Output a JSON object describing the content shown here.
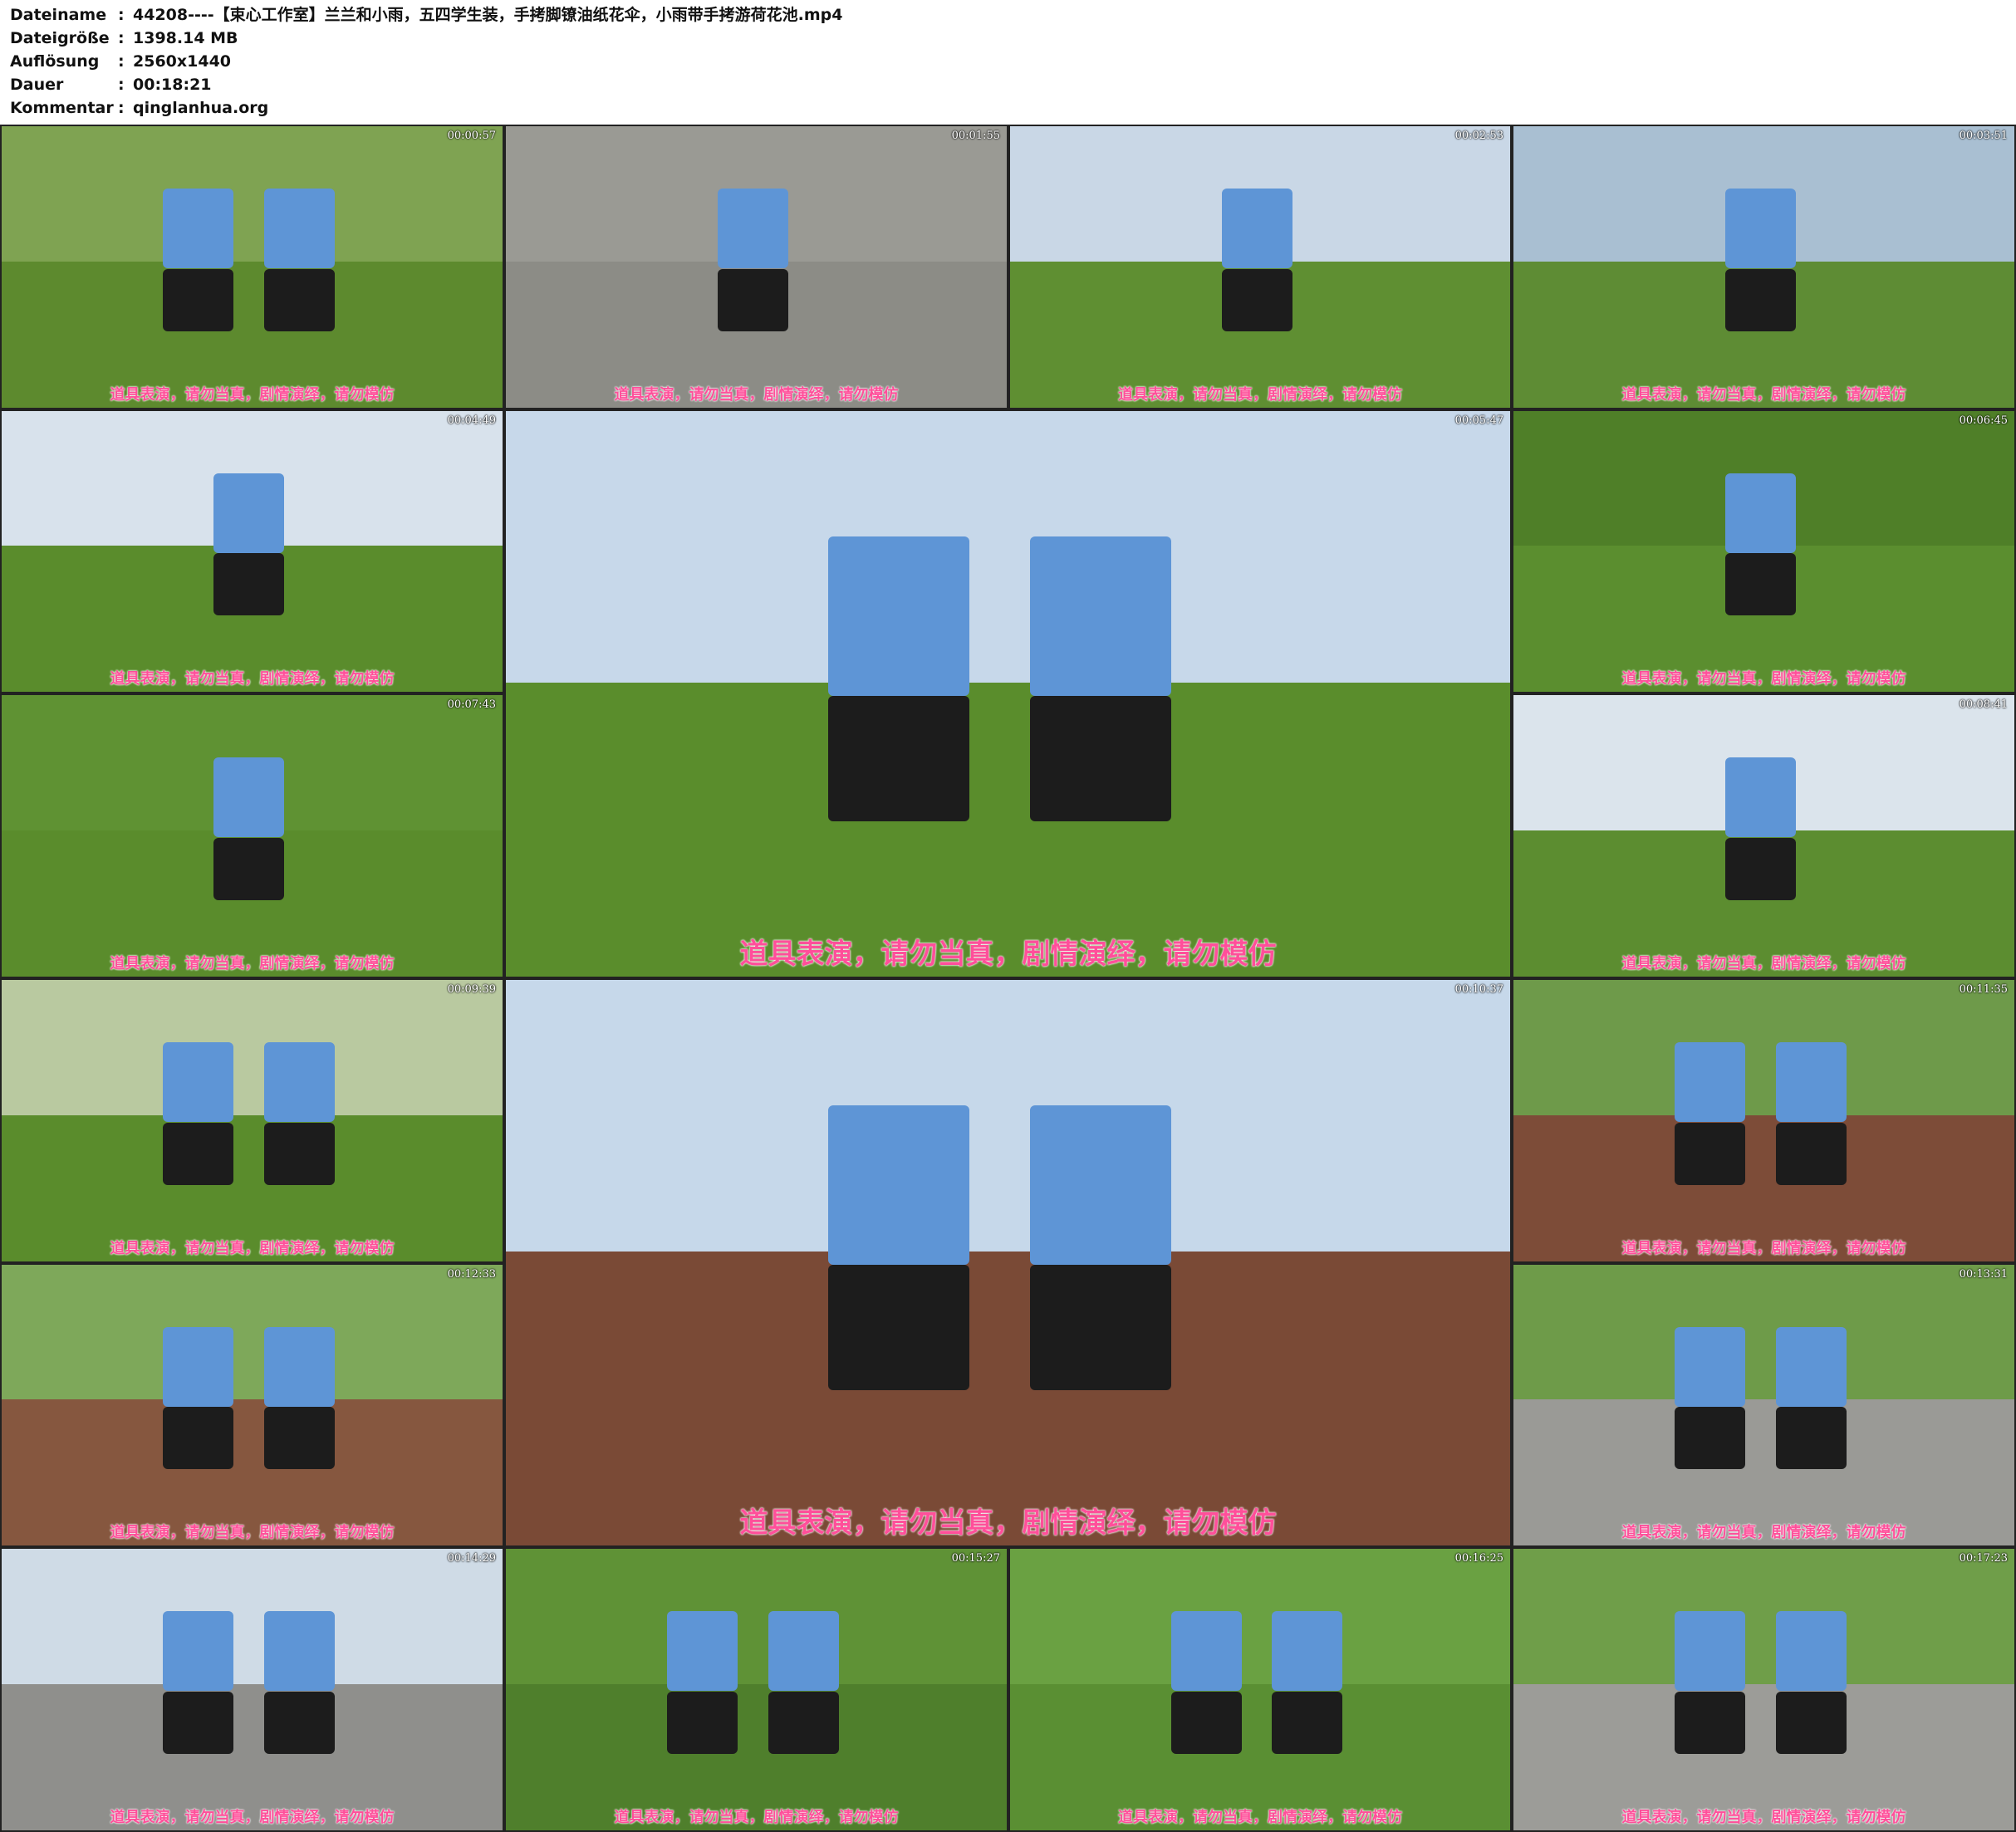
{
  "meta": [
    {
      "key": "Dateiname",
      "value": "44208----【束心工作室】兰兰和小雨，五四学生装，手拷脚镣油纸花伞，小雨带手拷游荷花池.mp4"
    },
    {
      "key": "Dateigröße",
      "value": "1398.14 MB"
    },
    {
      "key": "Auflösung",
      "value": "2560x1440"
    },
    {
      "key": "Dauer",
      "value": "00:18:21"
    },
    {
      "key": "Kommentar",
      "value": "qinglanhua.org"
    }
  ],
  "colon": ":",
  "caption": "道具表演，请勿当真，剧情演绎，请勿模仿",
  "thumbnails": [
    {
      "timestamp": "00:00:57",
      "scene": "grass-path",
      "sky": "#7fa352",
      "ground": "#5d8a2e"
    },
    {
      "timestamp": "00:01:55",
      "scene": "pavement",
      "sky": "#9a9a94",
      "ground": "#8c8c86"
    },
    {
      "timestamp": "00:02:53",
      "scene": "statue-field",
      "sky": "#c9d7e6",
      "ground": "#5f8f32"
    },
    {
      "timestamp": "00:03:51",
      "scene": "statue-field",
      "sky": "#a9bfd2",
      "ground": "#5e8c34"
    },
    {
      "timestamp": "00:04:49",
      "scene": "grass-slope",
      "sky": "#d8e2ec",
      "ground": "#5a8c2c"
    },
    {
      "timestamp": "00:05:47",
      "scene": "willow-umbrella",
      "sky": "#c7d8ea",
      "ground": "#5a8d2c"
    },
    {
      "timestamp": "00:06:45",
      "scene": "feet-grass",
      "sky": "#4f7f28",
      "ground": "#5b8e2f"
    },
    {
      "timestamp": "00:07:43",
      "scene": "grass-slope",
      "sky": "#5f9233",
      "ground": "#5a8c2c"
    },
    {
      "timestamp": "00:08:41",
      "scene": "willow-field",
      "sky": "#dbe4ec",
      "ground": "#5c8d30"
    },
    {
      "timestamp": "00:09:39",
      "scene": "willow-umbrella",
      "sky": "#b9c9a0",
      "ground": "#5a8c2c"
    },
    {
      "timestamp": "00:10:37",
      "scene": "boardwalk-lotus",
      "sky": "#c6d8ea",
      "ground": "#7a4a36"
    },
    {
      "timestamp": "00:11:35",
      "scene": "boardwalk",
      "sky": "#6e9a4a",
      "ground": "#7d4c38"
    },
    {
      "timestamp": "00:12:33",
      "scene": "boardwalk-lotus",
      "sky": "#7ea85a",
      "ground": "#86573f"
    },
    {
      "timestamp": "00:13:31",
      "scene": "stone-path",
      "sky": "#6e9b49",
      "ground": "#9a9a96"
    },
    {
      "timestamp": "00:14:29",
      "scene": "stone-path",
      "sky": "#cfdbe6",
      "ground": "#8f8f8c"
    },
    {
      "timestamp": "00:15:27",
      "scene": "lotus-close",
      "sky": "#5f9236",
      "ground": "#4f7f2c"
    },
    {
      "timestamp": "00:16:25",
      "scene": "lotus-close",
      "sky": "#6aa142",
      "ground": "#5a8f33"
    },
    {
      "timestamp": "00:17:23",
      "scene": "stone-path",
      "sky": "#6f9e49",
      "ground": "#9c9c98"
    }
  ]
}
